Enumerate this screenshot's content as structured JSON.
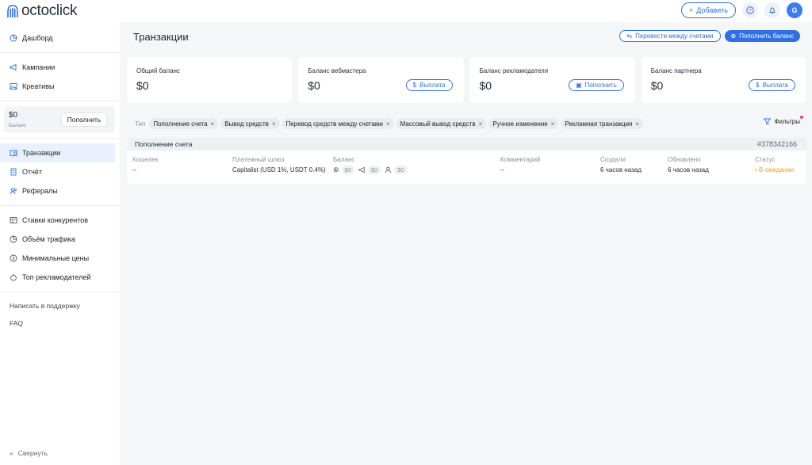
{
  "app": {
    "brand": "octoclick"
  },
  "topbar": {
    "add_label": "Добавить",
    "avatar_letter": "G"
  },
  "sidebar": {
    "dashboard": "Дашборд",
    "campaigns": "Кампании",
    "creatives": "Креативы",
    "balance_amount": "$0",
    "balance_label": "Баланс",
    "topup_label": "Пополнить",
    "transactions": "Транзакции",
    "report": "Отчёт",
    "referrals": "Рефералы",
    "competitor_bids": "Ставки конкурентов",
    "traffic_volume": "Объём трафика",
    "min_prices": "Минимальные цены",
    "top_advertisers": "Топ рекламодателей",
    "support": "Написать в поддержку",
    "faq": "FAQ",
    "collapse": "Свернуть"
  },
  "header": {
    "title": "Транзакции",
    "transfer_label": "Перевести между счетами",
    "topup_label": "Пополнить баланс"
  },
  "cards": [
    {
      "label": "Общий баланс",
      "value": "$0",
      "button": ""
    },
    {
      "label": "Баланс вебмастера",
      "value": "$0",
      "button": "Выплата"
    },
    {
      "label": "Баланс рекламодателя",
      "value": "$0",
      "button": "Пополнить"
    },
    {
      "label": "Баланс партнера",
      "value": "$0",
      "button": "Выплата"
    }
  ],
  "filters": {
    "type_label": "Тип",
    "chips": [
      "Пополнение счета",
      "Вывод средств",
      "Перевод средств между счетами",
      "Массовый вывод средств",
      "Ручное изменение",
      "Рекламная транзакция"
    ],
    "filters_label": "Фильтры"
  },
  "transaction": {
    "title": "Пополнение счета",
    "id": "#378342166",
    "wallet_h": "Кошелек",
    "wallet_v": "--",
    "gateway_h": "Платежный шлюз",
    "gateway_v": "Capitalist (USD 1%, USDT 0.4%)",
    "balance_h": "Баланс",
    "balance_vals": [
      "$0",
      "$0",
      "$0"
    ],
    "comment_h": "Комментарий",
    "comment_v": "--",
    "created_h": "Создали",
    "created_v": "6 часов назад",
    "updated_h": "Обновлено",
    "updated_v": "6 часов назад",
    "status_h": "Статус",
    "status_v": "В ожидании"
  },
  "colors": {
    "accent": "#2f6fe6",
    "pending": "#f0a020",
    "notification_dot": "#e8416c"
  }
}
